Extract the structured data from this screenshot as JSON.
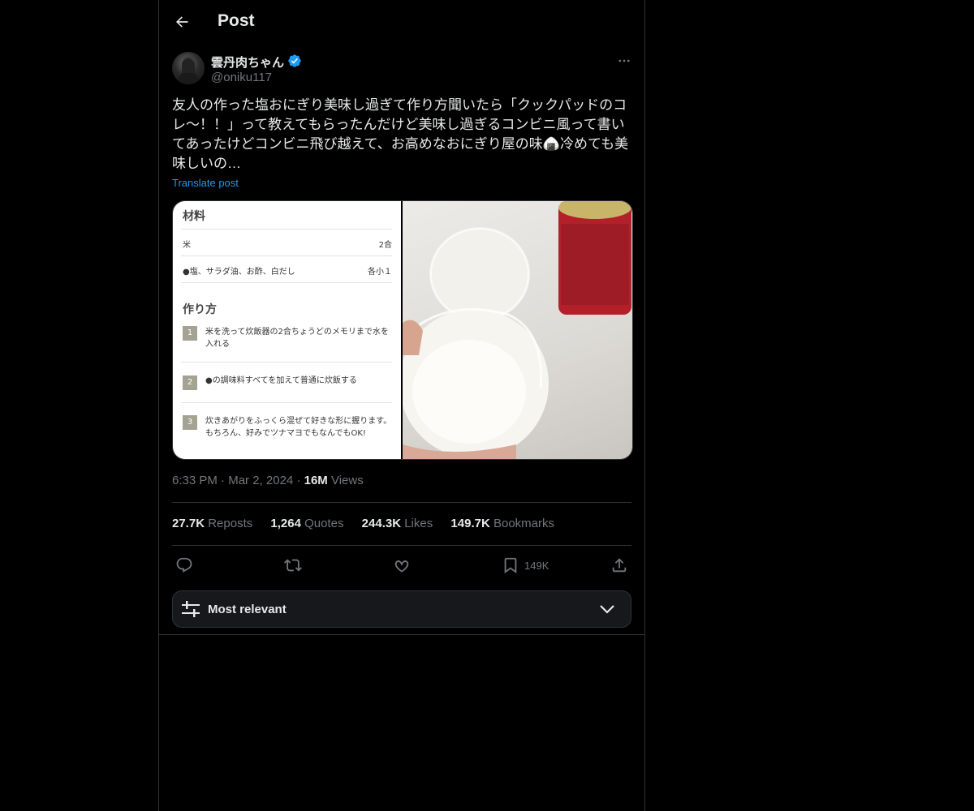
{
  "header": {
    "title": "Post"
  },
  "author": {
    "display_name": "雲丹肉ちゃん",
    "handle": "@oniku117",
    "verified": true
  },
  "post": {
    "text": "友人の作った塩おにぎり美味し過ぎて作り方聞いたら「クックパッドのコレ〜！！」って教えてもらったんだけど美味し過ぎるコンビニ風って書いてあったけどコンビニ飛び越えて、お高めなおにぎり屋の味🍙冷めても美味しいの…",
    "translate_label": "Translate post"
  },
  "media": {
    "recipe": {
      "ingredients_title": "材料",
      "ingredients": [
        {
          "name": "米",
          "amount": "2合"
        },
        {
          "name": "●塩、サラダ油、お酢、白だし",
          "amount": "各小１"
        }
      ],
      "steps_title": "作り方",
      "steps": [
        {
          "num": "1",
          "text": "米を洗って炊飯器の2合ちょうどのメモリまで水を入れる"
        },
        {
          "num": "2",
          "text": "●の調味料すべてを加えて普通に炊飯する"
        },
        {
          "num": "3",
          "text": "炊きあがりをふっくら混ぜて好きな形に握ります。もちろん、好みでツナマヨでもなんでもOK!"
        }
      ]
    }
  },
  "meta": {
    "time": "6:33 PM",
    "separator": "·",
    "date": "Mar 2, 2024",
    "views_count": "16M",
    "views_label": "Views"
  },
  "stats": [
    {
      "count": "27.7K",
      "label": "Reposts"
    },
    {
      "count": "1,264",
      "label": "Quotes"
    },
    {
      "count": "244.3K",
      "label": "Likes"
    },
    {
      "count": "149.7K",
      "label": "Bookmarks"
    }
  ],
  "actions": {
    "reply_icon": "reply-icon",
    "repost_icon": "repost-icon",
    "like_icon": "heart-icon",
    "bookmark_icon": "bookmark-icon",
    "bookmark_count": "149K",
    "share_icon": "share-icon"
  },
  "sort": {
    "label": "Most relevant"
  },
  "colors": {
    "accent": "#1d9bf0",
    "text": "#e7e9ea",
    "muted": "#71767b",
    "border": "#2f3336"
  }
}
